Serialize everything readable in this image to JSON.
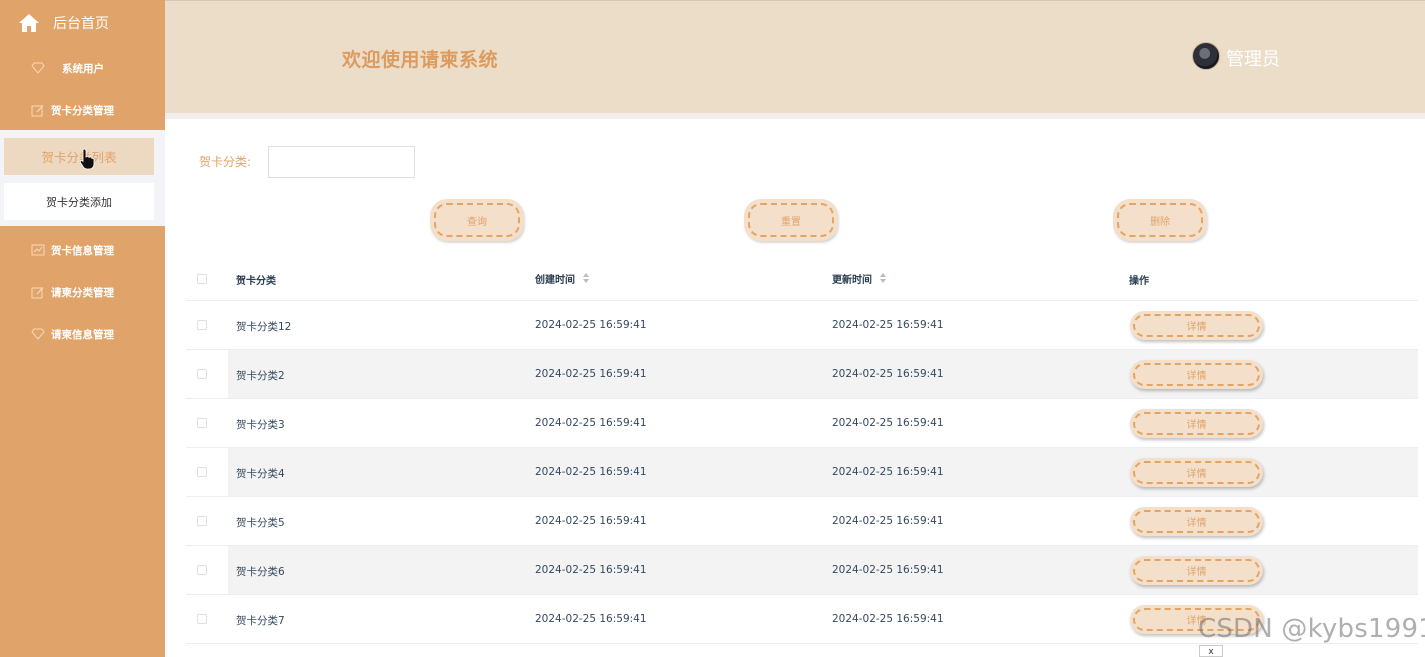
{
  "colors": {
    "sidebar": "#e0a36a",
    "header": "#ecddc9",
    "accent": "#dc9b5f",
    "button_bg": "#f3dfca"
  },
  "sidebar": {
    "home": {
      "label": "后台首页",
      "icon": "home-icon"
    },
    "items": [
      {
        "label": "系统用户",
        "icon": "diamond-icon"
      },
      {
        "label": "贺卡分类管理",
        "icon": "edit-icon"
      },
      {
        "label": "贺卡信息管理",
        "icon": "chart-icon"
      },
      {
        "label": "请柬分类管理",
        "icon": "edit-icon"
      },
      {
        "label": "请柬信息管理",
        "icon": "diamond-icon"
      }
    ],
    "submenu": [
      {
        "label": "贺卡分类列表",
        "active": true
      },
      {
        "label": "贺卡分类添加",
        "active": false
      }
    ]
  },
  "header": {
    "title": "欢迎使用请柬系统",
    "user": "管理员"
  },
  "search": {
    "label": "贺卡分类:",
    "value": "",
    "placeholder": ""
  },
  "actions": {
    "query": "查询",
    "reset": "重置",
    "delete": "删除"
  },
  "table": {
    "columns": [
      "贺卡分类",
      "创建时间",
      "更新时间",
      "操作"
    ],
    "detail_label": "详情",
    "rows": [
      {
        "category": "贺卡分类12",
        "created": "2024-02-25 16:59:41",
        "updated": "2024-02-25 16:59:41"
      },
      {
        "category": "贺卡分类2",
        "created": "2024-02-25 16:59:41",
        "updated": "2024-02-25 16:59:41"
      },
      {
        "category": "贺卡分类3",
        "created": "2024-02-25 16:59:41",
        "updated": "2024-02-25 16:59:41"
      },
      {
        "category": "贺卡分类4",
        "created": "2024-02-25 16:59:41",
        "updated": "2024-02-25 16:59:41"
      },
      {
        "category": "贺卡分类5",
        "created": "2024-02-25 16:59:41",
        "updated": "2024-02-25 16:59:41"
      },
      {
        "category": "贺卡分类6",
        "created": "2024-02-25 16:59:41",
        "updated": "2024-02-25 16:59:41"
      },
      {
        "category": "贺卡分类7",
        "created": "2024-02-25 16:59:41",
        "updated": "2024-02-25 16:59:41"
      }
    ]
  },
  "watermark": "CSDN @kybs1991",
  "close_tip": "x"
}
